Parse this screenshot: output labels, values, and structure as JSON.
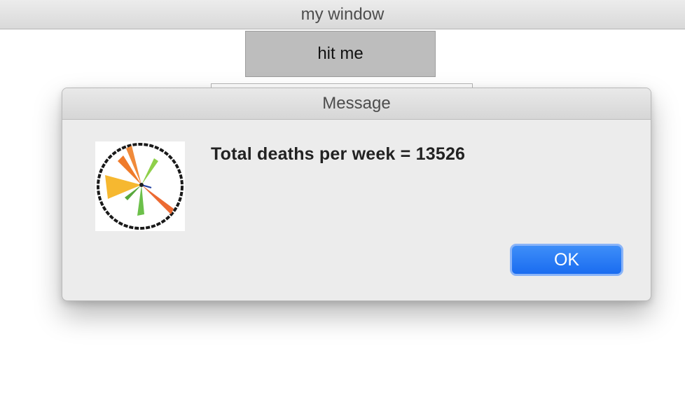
{
  "window": {
    "title": "my window"
  },
  "main": {
    "hit_button_label": "hit me"
  },
  "dialog": {
    "title": "Message",
    "message": "Total deaths per week = 13526",
    "icon": "pie-chart-dialog-icon",
    "ok_label": "OK",
    "colors": {
      "ok_button": "#1a6cf0",
      "ok_focus_ring": "#8ab4f8"
    }
  }
}
